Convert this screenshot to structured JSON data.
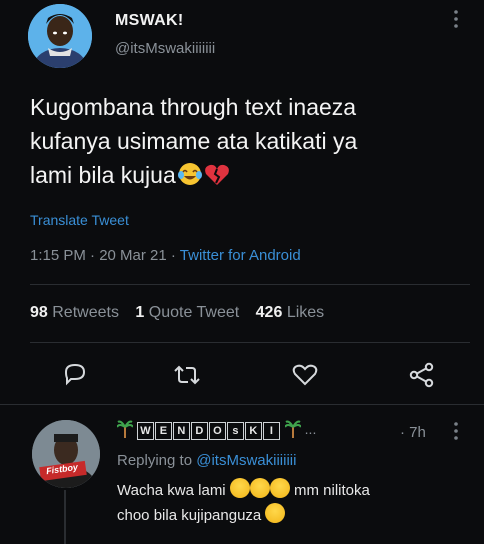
{
  "tweet": {
    "author_name": "MSWAK!",
    "author_handle": "@itsMswakiiiiiii",
    "text_line1": "Kugombana through text inaeza",
    "text_line2": "kufanya usimame ata katikati ya",
    "text_line3": "lami bila kujua",
    "translate_label": "Translate Tweet",
    "timestamp": "1:15 PM · 20 Mar 21 · ",
    "source": "Twitter for Android",
    "retweets_count": "98",
    "retweets_label": "Retweets",
    "quotes_count": "1",
    "quotes_label": "Quote Tweet",
    "likes_count": "426",
    "likes_label": "Likes"
  },
  "reply": {
    "author_letters": [
      "W",
      "E",
      "N",
      "D",
      "O",
      "s",
      "K",
      "I"
    ],
    "time": "· 7h",
    "replying_prefix": "Replying to ",
    "replying_handle": "@itsMswakiiiiiii",
    "text_part1": "Wacha kwa lami",
    "text_part2": "mm nilitoka",
    "text_line2": "choo bila kujipanguza",
    "avatar_text": "Fistboy"
  },
  "icons": {
    "more": "more-vertical-icon",
    "reply": "reply-icon",
    "retweet": "retweet-icon",
    "like": "heart-icon",
    "share": "share-icon"
  },
  "colors": {
    "background": "#0b0c0e",
    "link": "#3a8fd6",
    "muted": "#8a9198"
  }
}
